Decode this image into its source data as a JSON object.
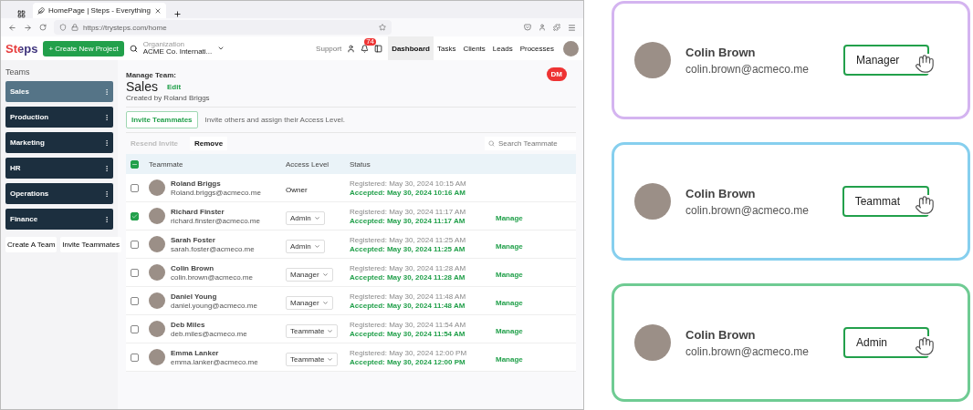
{
  "browser": {
    "tab_title": "HomePage | Steps - Everything",
    "url": "https://trysteps.com/home"
  },
  "header": {
    "logo": "Steps",
    "create_button": "+ Create New Project",
    "org_label": "Organization",
    "org_value": "ACME Co. Internati...",
    "support": "Support",
    "notifications": "74",
    "nav": [
      {
        "label": "Dashboard",
        "selected": true
      },
      {
        "label": "Tasks",
        "selected": false
      },
      {
        "label": "Clients",
        "selected": false
      },
      {
        "label": "Leads",
        "selected": false
      },
      {
        "label": "Processes",
        "selected": false
      }
    ]
  },
  "sidebar": {
    "title": "Teams",
    "teams": [
      {
        "label": "Sales",
        "selected": true
      },
      {
        "label": "Production",
        "selected": false
      },
      {
        "label": "Marketing",
        "selected": false
      },
      {
        "label": "HR",
        "selected": false
      },
      {
        "label": "Operations",
        "selected": false
      },
      {
        "label": "Finance",
        "selected": false
      }
    ],
    "buttons": [
      "Create A Team",
      "Invite Teammates"
    ]
  },
  "main": {
    "kicker": "Manage Team:",
    "title": "Sales",
    "edit": "Edit",
    "created_by": "Created by Roland Briggs",
    "dm_badge": "DM",
    "invite_button": "Invite Teammates",
    "invite_text": "Invite others and assign their Access Level.",
    "actions": [
      {
        "label": "Resend Invite",
        "disabled": true
      },
      {
        "label": "Remove",
        "disabled": false
      }
    ],
    "search": {
      "placeholder": "Search Teammate"
    },
    "table": {
      "select_all_checked": true,
      "columns": [
        "Teammate",
        "Access Level",
        "Status"
      ],
      "rows": [
        {
          "name": "Roland Briggs",
          "email": "Roland.briggs@acmeco.me",
          "checked": false,
          "access": {
            "kind": "text",
            "value": "Owner"
          },
          "registered": "Registered: May 30, 2024 10:15 AM",
          "accepted": "Accepted: May 30, 2024 10:16 AM"
        },
        {
          "name": "Richard Finster",
          "email": "richard.finster@acmeco.me",
          "checked": true,
          "access": {
            "kind": "select",
            "value": "Admin"
          },
          "registered": "Registered: May 30, 2024 11:17 AM",
          "accepted": "Accepted: May 30, 2024 11:17 AM",
          "action": "Manage"
        },
        {
          "name": "Sarah Foster",
          "email": "sarah.foster@acmeco.me",
          "checked": false,
          "access": {
            "kind": "select",
            "value": "Admin"
          },
          "registered": "Registered: May 30, 2024 11:25 AM",
          "accepted": "Accepted: May 30, 2024 11:25 AM",
          "action": "Manage"
        },
        {
          "name": "Colin Brown",
          "email": "colin.brown@acmeco.me",
          "checked": false,
          "access": {
            "kind": "select",
            "value": "Manager"
          },
          "registered": "Registered: May 30, 2024 11:28 AM",
          "accepted": "Accepted: May 30, 2024 11:28 AM",
          "action": "Manage"
        },
        {
          "name": "Daniel Young",
          "email": "daniel.young@acmeco.me",
          "checked": false,
          "access": {
            "kind": "select",
            "value": "Manager"
          },
          "registered": "Registered: May 30, 2024 11:48 AM",
          "accepted": "Accepted: May 30, 2024 11:48 AM",
          "action": "Manage"
        },
        {
          "name": "Deb Miles",
          "email": "deb.miles@acmeco.me",
          "checked": false,
          "access": {
            "kind": "select",
            "value": "Teammate"
          },
          "registered": "Registered: May 30, 2024 11:54 AM",
          "accepted": "Accepted: May 30, 2024 11:54 AM",
          "action": "Manage"
        },
        {
          "name": "Emma Lanker",
          "email": "emma.lanker@acmeco.me",
          "checked": false,
          "access": {
            "kind": "select",
            "value": "Teammate"
          },
          "registered": "Registered: May 30, 2024 12:00 PM",
          "accepted": "Accepted: May 30, 2024 12:00 PM",
          "action": "Manage"
        }
      ]
    }
  },
  "cards": [
    {
      "color": "#d4b4f0",
      "name": "Colin Brown",
      "email": "colin.brown@acmeco.me",
      "role": "Manager"
    },
    {
      "color": "#86cfee",
      "name": "Colin Brown",
      "email": "colin.brown@acmeco.me",
      "role": "Teammat"
    },
    {
      "color": "#6fcb93",
      "name": "Colin Brown",
      "email": "colin.brown@acmeco.me",
      "role": "Admin"
    }
  ]
}
